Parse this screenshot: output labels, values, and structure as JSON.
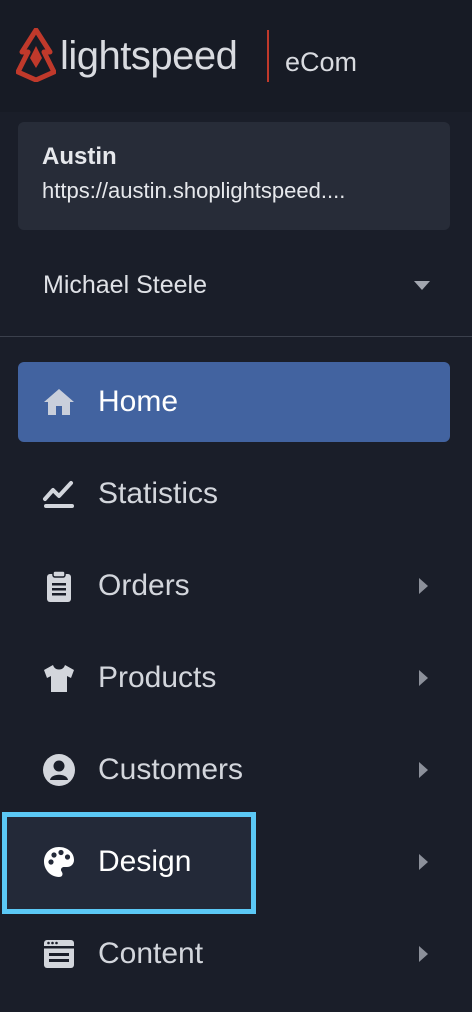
{
  "brand": {
    "name": "lightspeed",
    "product": "eCom",
    "accent_color": "#c0392b"
  },
  "store": {
    "name": "Austin",
    "url": "https://austin.shoplightspeed...."
  },
  "user": {
    "name": "Michael Steele",
    "dropdown_icon": "caret-down-icon"
  },
  "nav": {
    "active_color": "#4263a0",
    "highlight_color": "#5bc8f5",
    "items": [
      {
        "label": "Home",
        "icon": "home-icon",
        "active": true,
        "has_submenu": false
      },
      {
        "label": "Statistics",
        "icon": "chart-line-icon",
        "active": false,
        "has_submenu": false
      },
      {
        "label": "Orders",
        "icon": "clipboard-icon",
        "active": false,
        "has_submenu": true
      },
      {
        "label": "Products",
        "icon": "tshirt-icon",
        "active": false,
        "has_submenu": true
      },
      {
        "label": "Customers",
        "icon": "user-circle-icon",
        "active": false,
        "has_submenu": true
      },
      {
        "label": "Design",
        "icon": "palette-icon",
        "active": false,
        "has_submenu": true,
        "highlighted": true
      },
      {
        "label": "Content",
        "icon": "browser-window-icon",
        "active": false,
        "has_submenu": true
      }
    ]
  }
}
